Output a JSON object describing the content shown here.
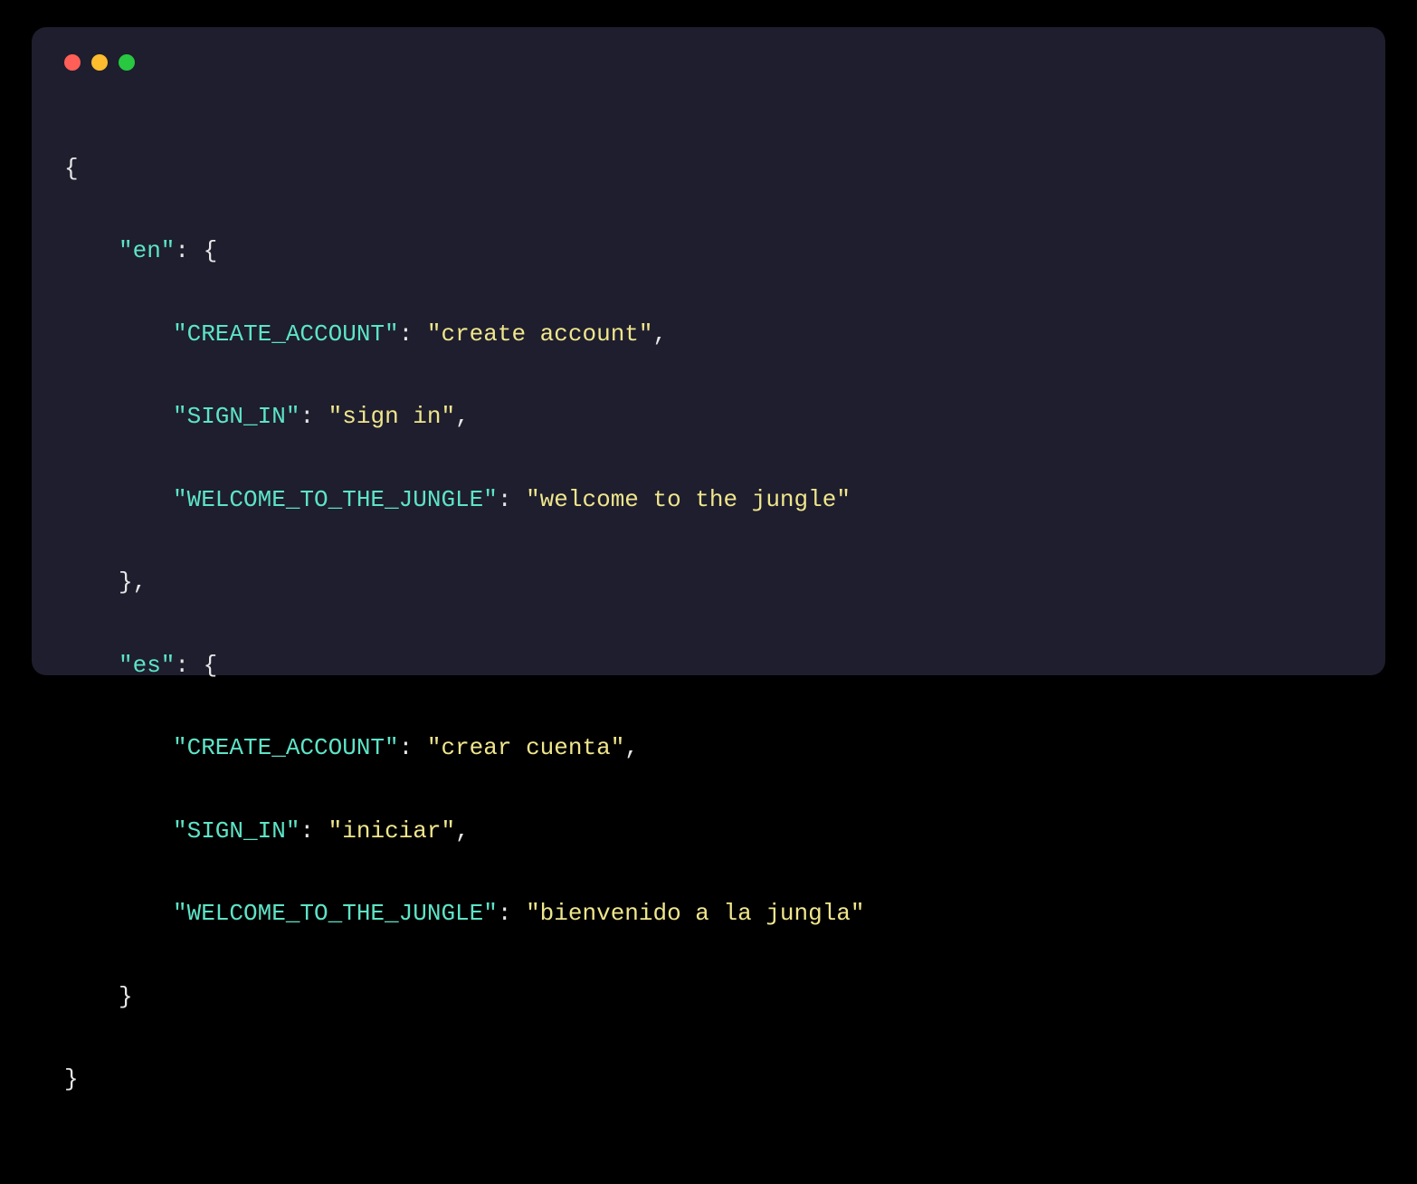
{
  "code": {
    "line0": "{",
    "line1_key": "\"en\"",
    "line1_rest": ": {",
    "line2_key": "\"CREATE_ACCOUNT\"",
    "line2_sep": ": ",
    "line2_val": "\"create account\"",
    "line2_end": ",",
    "line3_key": "\"SIGN_IN\"",
    "line3_sep": ": ",
    "line3_val": "\"sign in\"",
    "line3_end": ",",
    "line4_key": "\"WELCOME_TO_THE_JUNGLE\"",
    "line4_sep": ": ",
    "line4_val": "\"welcome to the jungle\"",
    "line5": "},",
    "line6_key": "\"es\"",
    "line6_rest": ": {",
    "line7_key": "\"CREATE_ACCOUNT\"",
    "line7_sep": ": ",
    "line7_val": "\"crear cuenta\"",
    "line7_end": ",",
    "line8_key": "\"SIGN_IN\"",
    "line8_sep": ": ",
    "line8_val": "\"iniciar\"",
    "line8_end": ",",
    "line9_key": "\"WELCOME_TO_THE_JUNGLE\"",
    "line9_sep": ": ",
    "line9_val": "\"bienvenido a la jungla\"",
    "line10": "}",
    "line11": "}"
  }
}
